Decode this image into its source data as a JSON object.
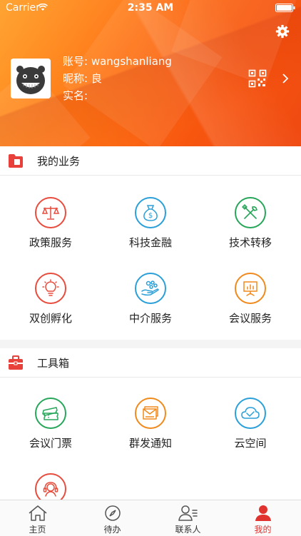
{
  "status_bar": {
    "carrier": "Carrier",
    "time": "2:35 AM"
  },
  "profile": {
    "account_label": "账号:",
    "account": "wangshanliang",
    "nickname_label": "昵称:",
    "nickname": "良",
    "realname_label": "实名:",
    "realname": ""
  },
  "business": {
    "title": "我的业务",
    "items": [
      {
        "label": "政策服务",
        "icon": "scales-icon",
        "color": "#e84c3d"
      },
      {
        "label": "科技金融",
        "icon": "money-bag-icon",
        "color": "#2a9fd8"
      },
      {
        "label": "技术转移",
        "icon": "tools-icon",
        "color": "#27a65a"
      },
      {
        "label": "双创孵化",
        "icon": "lightbulb-icon",
        "color": "#e84c3d"
      },
      {
        "label": "中介服务",
        "icon": "hand-icon",
        "color": "#2a9fd8"
      },
      {
        "label": "会议服务",
        "icon": "presentation-icon",
        "color": "#f08a1c"
      }
    ]
  },
  "toolbox": {
    "title": "工具箱",
    "items": [
      {
        "label": "会议门票",
        "icon": "ticket-icon",
        "color": "#27a65a"
      },
      {
        "label": "群发通知",
        "icon": "envelope-icon",
        "color": "#f08a1c"
      },
      {
        "label": "云空间",
        "icon": "cloud-icon",
        "color": "#2a9fd8"
      },
      {
        "label": "",
        "icon": "headset-icon",
        "color": "#e84c3d"
      }
    ]
  },
  "tabs": [
    {
      "label": "主页",
      "icon": "home-icon",
      "active": false
    },
    {
      "label": "待办",
      "icon": "compass-icon",
      "active": false
    },
    {
      "label": "联系人",
      "icon": "contacts-icon",
      "active": false
    },
    {
      "label": "我的",
      "icon": "person-icon",
      "active": true
    }
  ],
  "colors": {
    "accent": "#e0322e",
    "header_orange": "#ff7a18"
  }
}
